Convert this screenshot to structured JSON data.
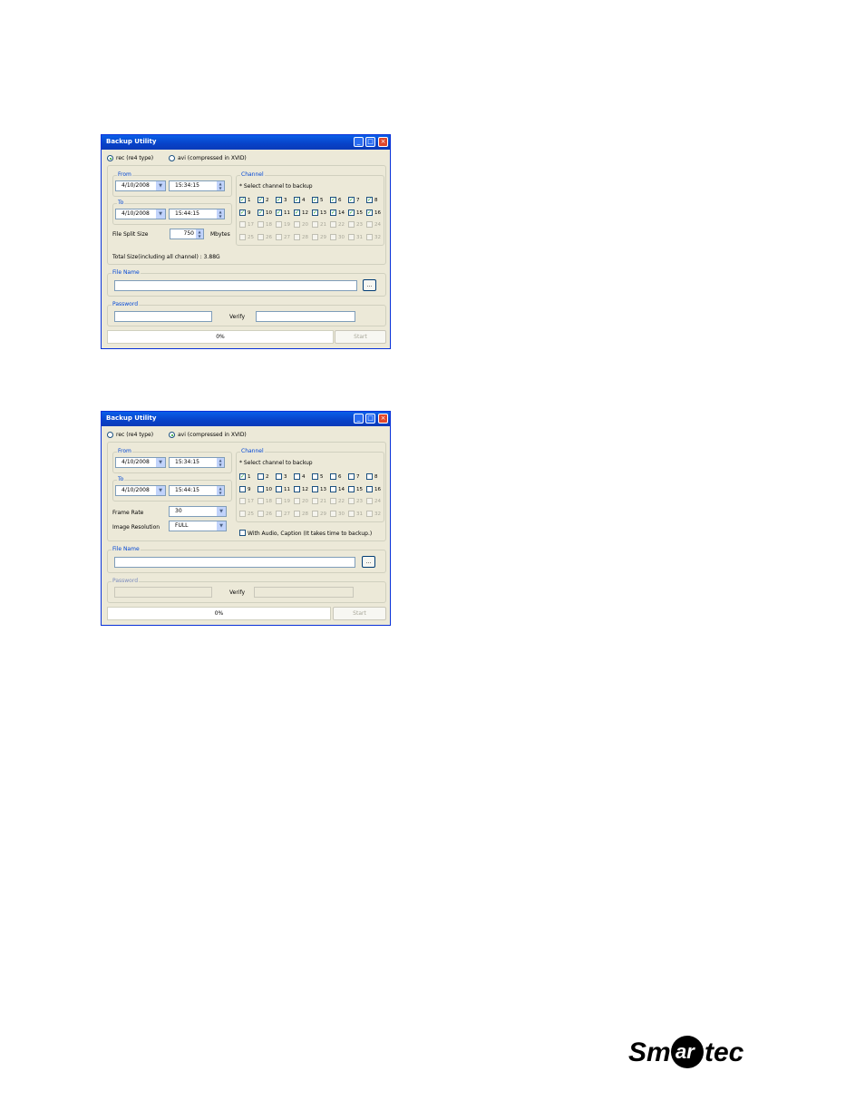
{
  "windows": [
    {
      "title": "Backup  Utility",
      "format": {
        "rec_label": "rec (re4 type)",
        "avi_label": "avi (compressed in XVID)",
        "selected": "rec"
      },
      "from": {
        "label": "From",
        "date": "4/10/2008",
        "time": "15:34:15"
      },
      "to": {
        "label": "To",
        "date": "4/10/2008",
        "time": "15:44:15"
      },
      "file_split": {
        "label": "File Split Size",
        "value": "750",
        "unit": "Mbytes"
      },
      "total_size": "Total Size(including all channel) : 3.88G",
      "channel": {
        "label": "Channel",
        "instruction": "* Select channel to backup",
        "checked": [
          1,
          2,
          3,
          4,
          5,
          6,
          7,
          8,
          9,
          10,
          11,
          12,
          13,
          14,
          15,
          16
        ],
        "enabled_max": 16
      },
      "file_name": {
        "label": "File Name",
        "value": "",
        "browse_label": "..."
      },
      "password": {
        "label": "Password",
        "verify_label": "Verify",
        "enabled": true
      },
      "progress": "0%",
      "start_label": "Start"
    },
    {
      "title": "Backup  Utility",
      "format": {
        "rec_label": "rec (re4 type)",
        "avi_label": "avi (compressed in XVID)",
        "selected": "avi"
      },
      "from": {
        "label": "From",
        "date": "4/10/2008",
        "time": "15:34:15"
      },
      "to": {
        "label": "To",
        "date": "4/10/2008",
        "time": "15:44:15"
      },
      "frame_rate": {
        "label": "Frame Rate",
        "value": "30"
      },
      "image_resolution": {
        "label": "Image Resolution",
        "value": "FULL"
      },
      "channel": {
        "label": "Channel",
        "instruction": "* Select channel to backup",
        "checked": [
          1
        ],
        "enabled_max": 16
      },
      "audio_caption": {
        "label": "With Audio, Caption (It takes time to backup.)",
        "checked": false
      },
      "file_name": {
        "label": "File Name",
        "value": "",
        "browse_label": "..."
      },
      "password": {
        "label": "Password",
        "verify_label": "Verify",
        "enabled": false
      },
      "progress": "0%",
      "start_label": "Start"
    }
  ],
  "logo": {
    "text": "Smartec",
    "color": "#000000"
  },
  "colors": {
    "title_bar": "#0842c8",
    "group_label": "#0046d5",
    "check": "#21a121"
  }
}
